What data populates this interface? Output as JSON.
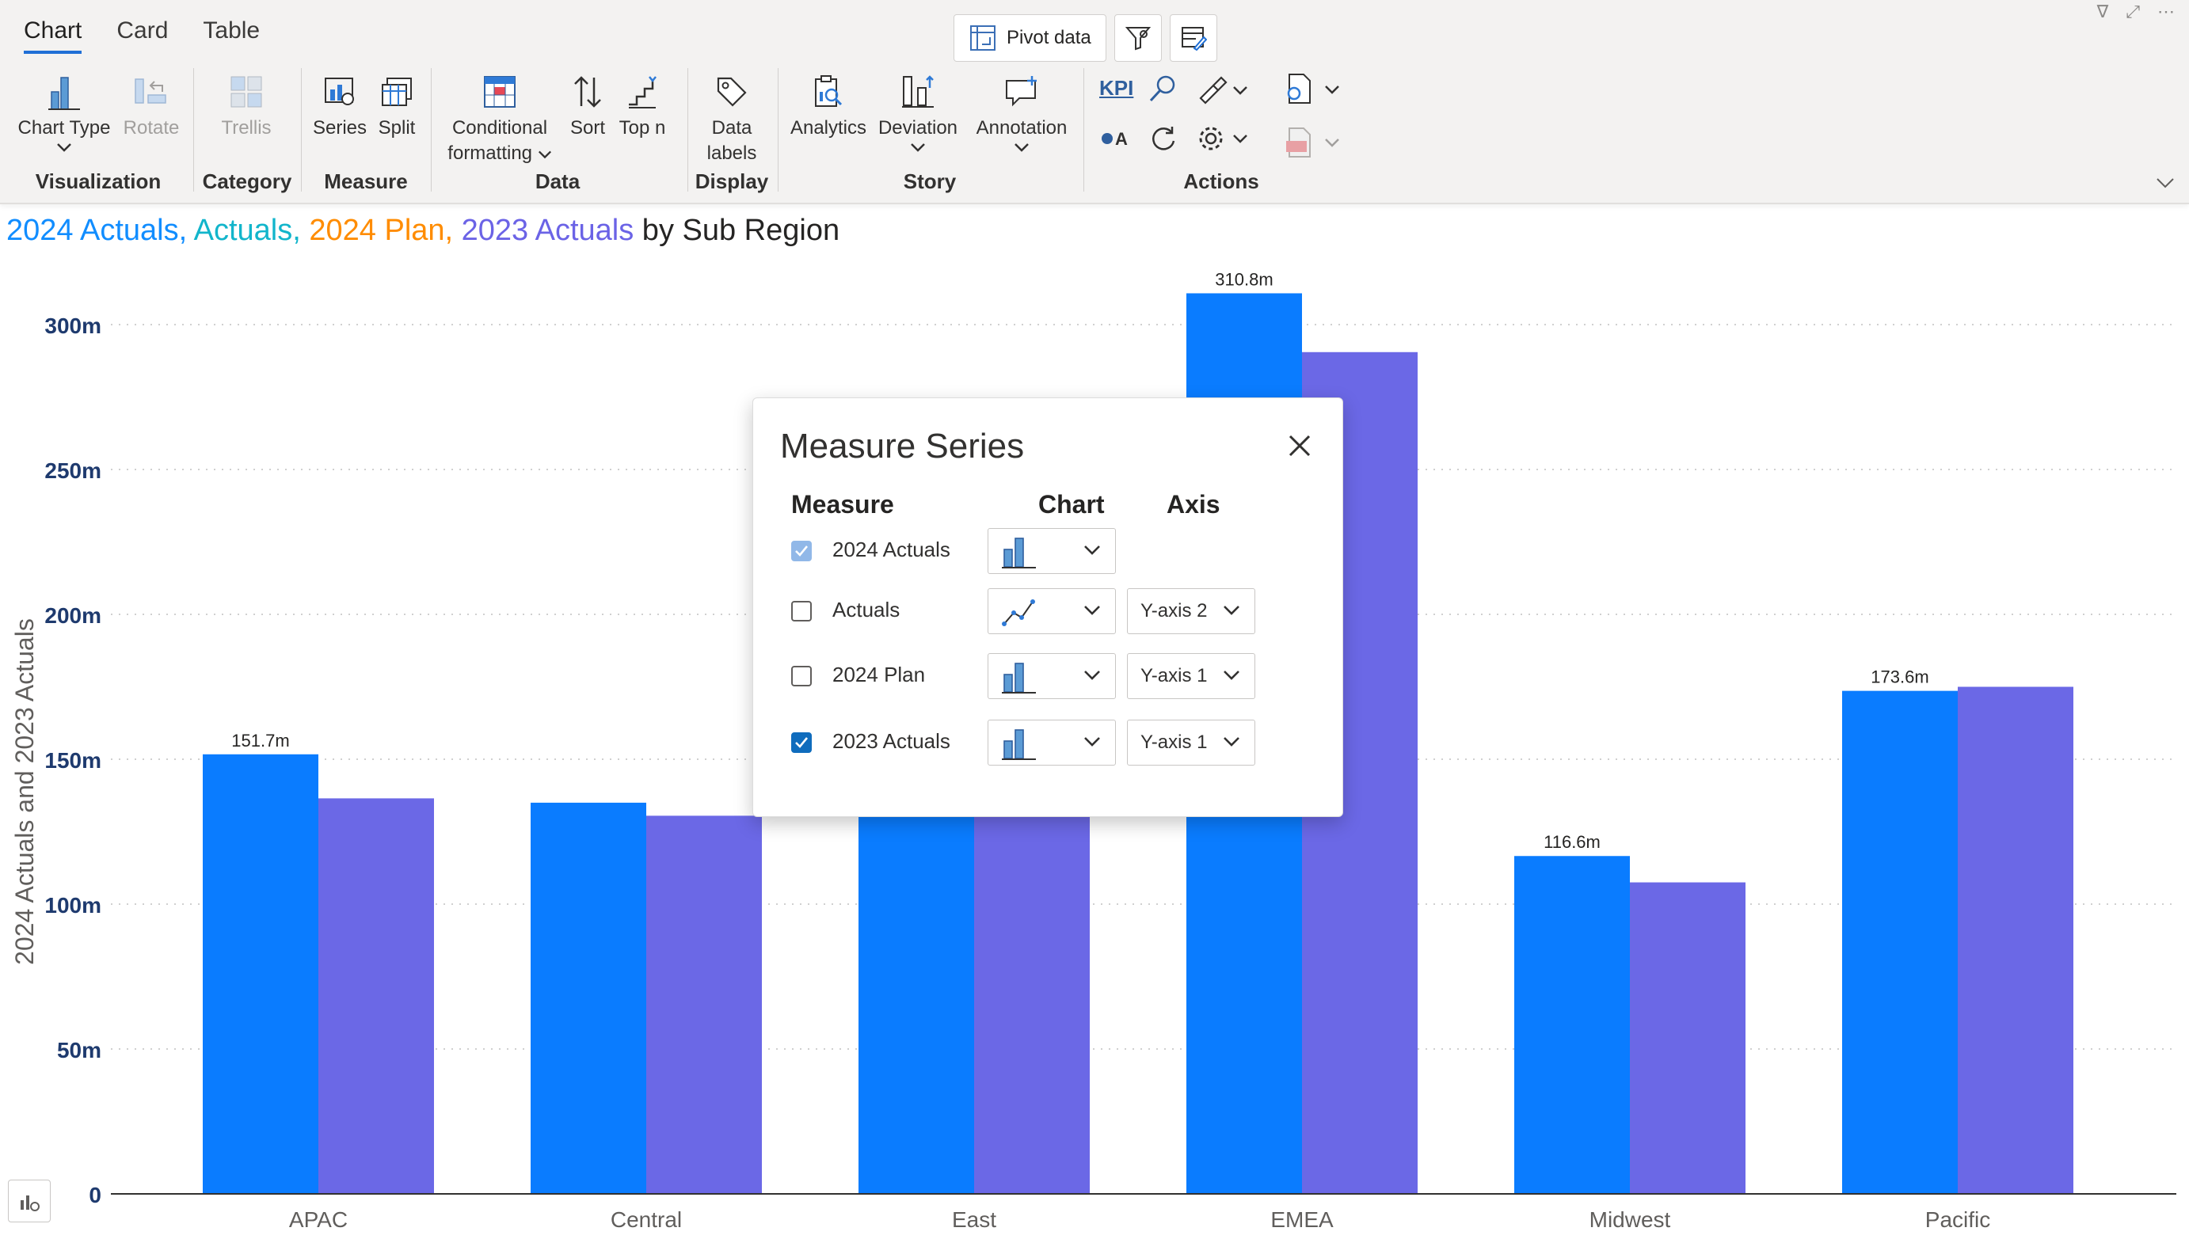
{
  "tabs": [
    {
      "label": "Chart",
      "active": true
    },
    {
      "label": "Card",
      "active": false
    },
    {
      "label": "Table",
      "active": false
    }
  ],
  "toolbar_top": {
    "pivot_label": "Pivot data"
  },
  "ribbon": {
    "chart_type": "Chart Type",
    "rotate": "Rotate",
    "trellis": "Trellis",
    "series": "Series",
    "split": "Split",
    "conditional_1": "Conditional",
    "conditional_2": "formatting",
    "sort": "Sort",
    "topn": "Top n",
    "data_labels_1": "Data",
    "data_labels_2": "labels",
    "analytics": "Analytics",
    "deviation": "Deviation",
    "annotation": "Annotation",
    "kpi": "KPI",
    "groups": {
      "visualization": "Visualization",
      "category": "Category",
      "measure": "Measure",
      "data": "Data",
      "display": "Display",
      "story": "Story",
      "actions": "Actions"
    }
  },
  "title": {
    "parts": [
      {
        "text": "2024 Actuals, ",
        "color": "#118dff"
      },
      {
        "text": "Actuals, ",
        "color": "#12b5cb"
      },
      {
        "text": "2024 Plan, ",
        "color": "#ff8c00"
      },
      {
        "text": "2023 Actuals",
        "color": "#6b63e6"
      },
      {
        "text": " by Sub Region",
        "color": "#252423"
      }
    ]
  },
  "chart_data": {
    "type": "bar",
    "categories": [
      "APAC",
      "Central",
      "East",
      "EMEA",
      "Midwest",
      "Pacific"
    ],
    "series": [
      {
        "name": "2024 Actuals",
        "color": "#0a7cff",
        "values": [
          151.7,
          135,
          150,
          310.8,
          116.6,
          173.6
        ],
        "labels": [
          "151.7m",
          "",
          "",
          "310.8m",
          "116.6m",
          "173.6m"
        ]
      },
      {
        "name": "2023 Actuals",
        "color": "#6b68e6",
        "values": [
          136.5,
          130.5,
          150,
          290.5,
          107.5,
          175
        ],
        "labels": [
          "",
          "",
          "",
          "",
          "",
          ""
        ]
      }
    ],
    "ylabel": "2024 Actuals and 2023 Actuals",
    "ylim": [
      0,
      320
    ],
    "yticks": [
      0,
      50,
      100,
      150,
      200,
      250,
      300
    ],
    "ytick_labels": [
      "0",
      "50m",
      "100m",
      "150m",
      "200m",
      "250m",
      "300m"
    ],
    "grid": true
  },
  "dialog": {
    "title": "Measure Series",
    "col_measure": "Measure",
    "col_chart": "Chart",
    "col_axis": "Axis",
    "rows": [
      {
        "label": "2024 Actuals",
        "checked": true,
        "dim": true,
        "chart": "column",
        "axis": ""
      },
      {
        "label": "Actuals",
        "checked": false,
        "dim": false,
        "chart": "line",
        "axis": "Y-axis 2"
      },
      {
        "label": "2024 Plan",
        "checked": false,
        "dim": false,
        "chart": "column",
        "axis": "Y-axis 1"
      },
      {
        "label": "2023 Actuals",
        "checked": true,
        "dim": false,
        "chart": "column",
        "axis": "Y-axis 1"
      }
    ]
  }
}
